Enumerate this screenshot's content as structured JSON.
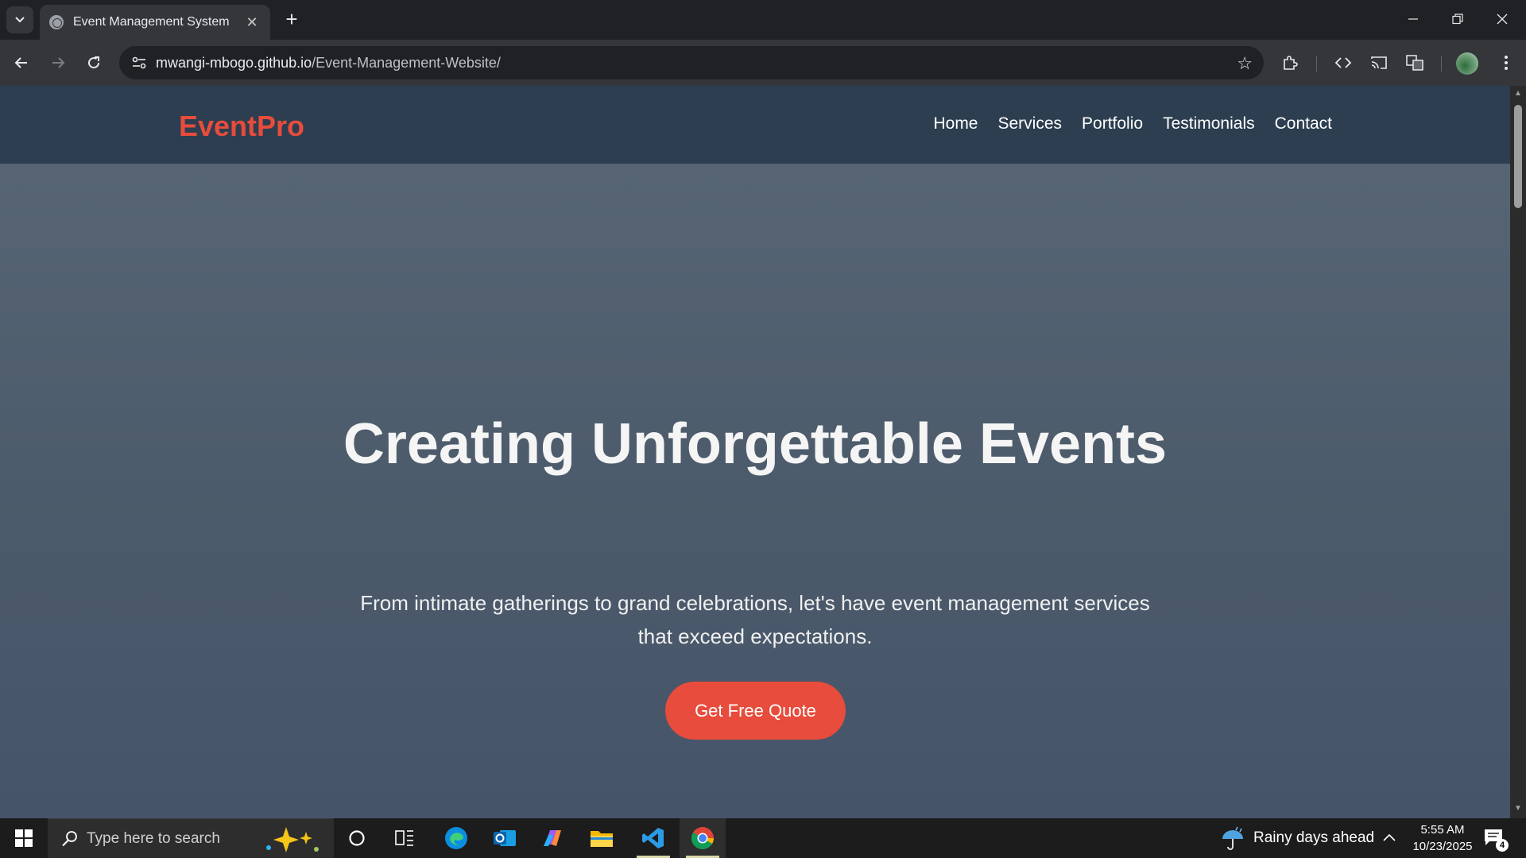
{
  "browser": {
    "tab_title": "Event Management System",
    "tab_close": "✕",
    "new_tab": "+",
    "url_host": "mwangi-mbogo.github.io",
    "url_path": "/Event-Management-Website/"
  },
  "site": {
    "logo": "EventPro",
    "nav": [
      "Home",
      "Services",
      "Portfolio",
      "Testimonials",
      "Contact"
    ],
    "hero_title": "Creating Unforgettable Events",
    "hero_subtitle": "From intimate gatherings to grand celebrations, let's have event management services that exceed expectations.",
    "cta_label": "Get Free Quote",
    "colors": {
      "accent": "#e74c3c",
      "header": "#2c3e50",
      "hero": "#4f5d6d"
    }
  },
  "taskbar": {
    "search_placeholder": "Type here to search",
    "weather": "Rainy days ahead",
    "time": "5:55 AM",
    "date": "10/23/2025",
    "notification_count": "4"
  }
}
